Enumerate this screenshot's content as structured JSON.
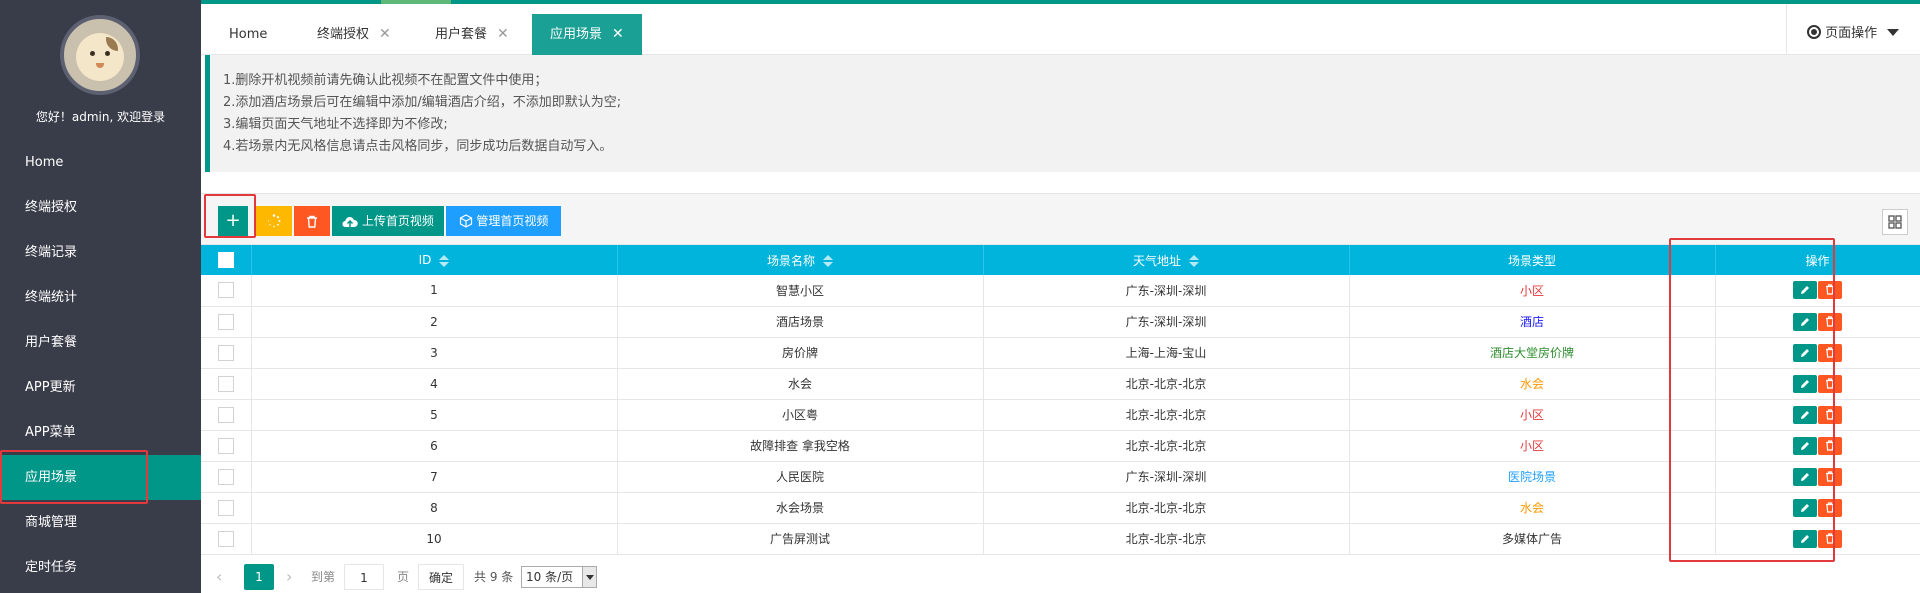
{
  "sidebar": {
    "welcome": "您好！admin, 欢迎登录",
    "items": [
      {
        "label": "Home"
      },
      {
        "label": "终端授权"
      },
      {
        "label": "终端记录"
      },
      {
        "label": "终端统计"
      },
      {
        "label": "用户套餐"
      },
      {
        "label": "APP更新"
      },
      {
        "label": "APP菜单"
      },
      {
        "label": "应用场景"
      },
      {
        "label": "商城管理"
      },
      {
        "label": "定时任务"
      }
    ],
    "active_index": 7
  },
  "tabs": [
    {
      "label": "Home"
    },
    {
      "label": "终端授权",
      "close": "✕"
    },
    {
      "label": "用户套餐",
      "close": "✕"
    },
    {
      "label": "应用场景",
      "close": "✕"
    }
  ],
  "page_ops": {
    "label": "页面操作"
  },
  "notice": [
    "1.删除开机视频前请先确认此视频不在配置文件中使用；",
    "2.添加酒店场景后可在编辑中添加/编辑酒店介绍，不添加即默认为空;",
    "3.编辑页面天气地址不选择即为不修改;",
    "4.若场景内无风格信息请点击风格同步，同步成功后数据自动写入。"
  ],
  "toolbar": {
    "add_label": "+",
    "upload_label": "上传首页视频",
    "manage_label": "管理首页视频"
  },
  "table": {
    "headers": {
      "id": "ID",
      "name": "场景名称",
      "weather": "天气地址",
      "type": "场景类型",
      "ops": "操作"
    },
    "rows": [
      {
        "id": "1",
        "name": "智慧小区",
        "weather": "广东-深圳-深圳",
        "type": "小区",
        "type_color": "#e4393c"
      },
      {
        "id": "2",
        "name": "酒店场景",
        "weather": "广东-深圳-深圳",
        "type": "酒店",
        "type_color": "#1a1aff"
      },
      {
        "id": "3",
        "name": "房价牌",
        "weather": "上海-上海-宝山",
        "type": "酒店大堂房价牌",
        "type_color": "#2e8b2e"
      },
      {
        "id": "4",
        "name": "水会",
        "weather": "北京-北京-北京",
        "type": "水会",
        "type_color": "#ff9800"
      },
      {
        "id": "5",
        "name": "小区粤",
        "weather": "北京-北京-北京",
        "type": "小区",
        "type_color": "#e4393c"
      },
      {
        "id": "6",
        "name": "故障排查 拿我空格",
        "weather": "北京-北京-北京",
        "type": "小区",
        "type_color": "#e4393c"
      },
      {
        "id": "7",
        "name": "人民医院",
        "weather": "广东-深圳-深圳",
        "type": "医院场景",
        "type_color": "#1e9fff"
      },
      {
        "id": "8",
        "name": "水会场景",
        "weather": "北京-北京-北京",
        "type": "水会",
        "type_color": "#ff9800"
      },
      {
        "id": "10",
        "name": "广告屏测试",
        "weather": "北京-北京-北京",
        "type": "多媒体广告",
        "type_color": "#333333"
      }
    ]
  },
  "pager": {
    "prev": "‹",
    "current": "1",
    "next": "›",
    "goto_label": "到第",
    "input_value": "1",
    "page_unit": "页",
    "ok_label": "确定",
    "total": "共 9 条",
    "page_size": "10 条/页"
  },
  "colors": {
    "primary": "#009688",
    "header": "#00b4dc",
    "sidebar": "#393d49",
    "highlight": "#e4393c"
  }
}
